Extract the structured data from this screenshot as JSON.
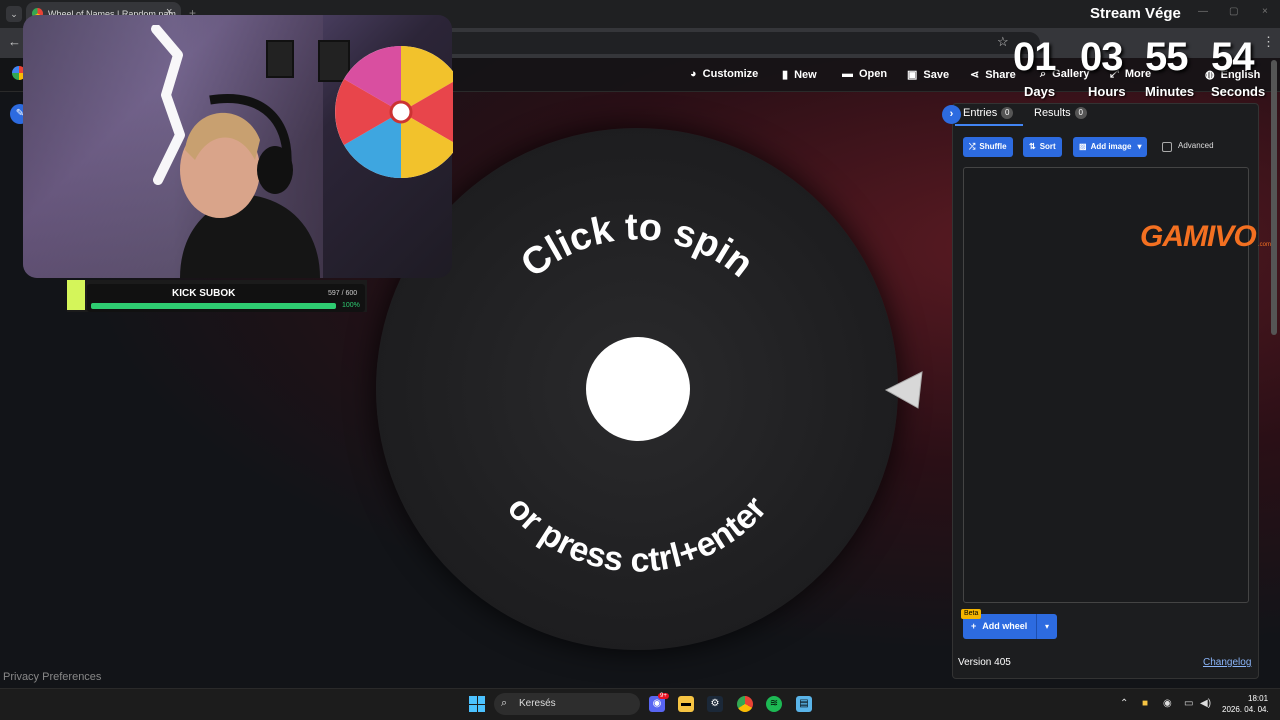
{
  "browser": {
    "tab_title": "Wheel of Names | Random nam",
    "tab_close": "×",
    "tab_menu": "⌄",
    "new_tab": "+",
    "window_title": "Stream Vége",
    "win_min": "—",
    "win_max": "▢",
    "win_close": "×",
    "back": "←",
    "star": "☆",
    "menu": "⋮"
  },
  "nav": {
    "customize": "Customize",
    "new": "New",
    "open": "Open",
    "save": "Save",
    "share": "Share",
    "gallery": "Gallery",
    "more": "More",
    "language": "English"
  },
  "wheel": {
    "top_text": "Click to spin",
    "bottom_text": "or press ctrl+enter"
  },
  "panel": {
    "tab_entries": "Entries",
    "tab_entries_count": "0",
    "tab_results": "Results",
    "tab_results_count": "0",
    "shuffle": "Shuffle",
    "sort": "Sort",
    "add_image": "Add image",
    "advanced": "Advanced",
    "beta": "Beta",
    "add_wheel": "Add wheel",
    "version": "Version 405",
    "changelog": "Changelog"
  },
  "countdown": {
    "days": "01",
    "hours": "03",
    "minutes": "55",
    "seconds": "54",
    "days_label": "Days",
    "hours_label": "Hours",
    "minutes_label": "Minutes",
    "seconds_label": "Seconds"
  },
  "sponsor": {
    "logo": "GAMIVO",
    "suffix": ".com"
  },
  "sub_goal": {
    "title": "KICK SUBOK",
    "count": "597 / 600",
    "percent_label": "100%",
    "progress": 0.995
  },
  "footer": {
    "privacy": "Privacy Preferences"
  },
  "taskbar": {
    "search_placeholder": "Keresés",
    "time": "18:01",
    "date": "2026. 04. 04.",
    "discord_badge": "9+"
  },
  "colors": {
    "accent_blue": "#2d6be0",
    "sub_green": "#2ecc71",
    "gamivo_orange": "#f37021"
  }
}
